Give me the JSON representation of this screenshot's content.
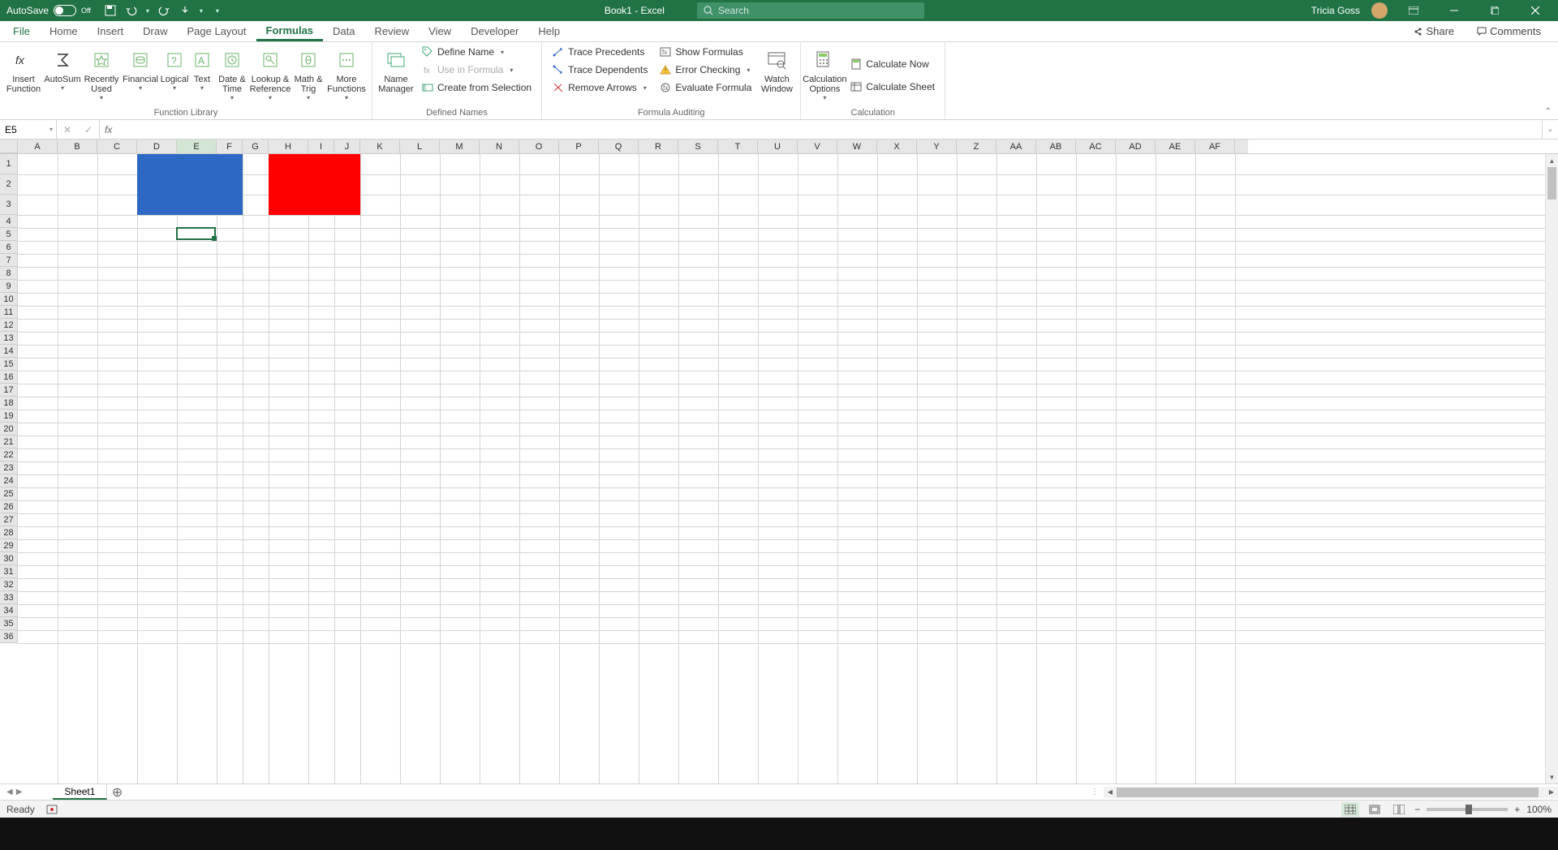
{
  "titlebar": {
    "autosave_label": "AutoSave",
    "autosave_state": "Off",
    "doc_title": "Book1  -  Excel",
    "search_placeholder": "Search",
    "user_name": "Tricia Goss"
  },
  "tabs": {
    "file": "File",
    "items": [
      "Home",
      "Insert",
      "Draw",
      "Page Layout",
      "Formulas",
      "Data",
      "Review",
      "View",
      "Developer",
      "Help"
    ],
    "active": "Formulas",
    "share": "Share",
    "comments": "Comments"
  },
  "ribbon": {
    "function_library": {
      "label": "Function Library",
      "insert_function": "Insert\nFunction",
      "autosum": "AutoSum",
      "recently_used": "Recently\nUsed",
      "financial": "Financial",
      "logical": "Logical",
      "text": "Text",
      "date_time": "Date &\nTime",
      "lookup_ref": "Lookup &\nReference",
      "math_trig": "Math &\nTrig",
      "more_functions": "More\nFunctions"
    },
    "defined_names": {
      "label": "Defined Names",
      "name_manager": "Name\nManager",
      "define_name": "Define Name",
      "use_in_formula": "Use in Formula",
      "create_from_selection": "Create from Selection"
    },
    "formula_auditing": {
      "label": "Formula Auditing",
      "trace_precedents": "Trace Precedents",
      "trace_dependents": "Trace Dependents",
      "remove_arrows": "Remove Arrows",
      "show_formulas": "Show Formulas",
      "error_checking": "Error Checking",
      "evaluate_formula": "Evaluate Formula",
      "watch_window": "Watch\nWindow"
    },
    "calculation": {
      "label": "Calculation",
      "calculation_options": "Calculation\nOptions",
      "calculate_now": "Calculate Now",
      "calculate_sheet": "Calculate Sheet"
    }
  },
  "formula_bar": {
    "name_box": "E5",
    "fx": "fx"
  },
  "grid": {
    "columns": [
      "A",
      "B",
      "C",
      "D",
      "E",
      "F",
      "G",
      "H",
      "I",
      "J",
      "K",
      "L",
      "M",
      "N",
      "O",
      "P",
      "Q",
      "R",
      "S",
      "T",
      "U",
      "V",
      "W",
      "X",
      "Y",
      "Z",
      "AA",
      "AB",
      "AC",
      "AD",
      "AE",
      "AF"
    ],
    "visible_rows": 36,
    "selected_cell": "E5",
    "fills": [
      {
        "range": "D1:F3",
        "color": "#2d68c4"
      },
      {
        "range": "H1:J3",
        "color": "#ff0000"
      }
    ]
  },
  "sheets": {
    "active": "Sheet1",
    "tabs": [
      "Sheet1"
    ]
  },
  "status": {
    "ready": "Ready",
    "zoom": "100%"
  }
}
